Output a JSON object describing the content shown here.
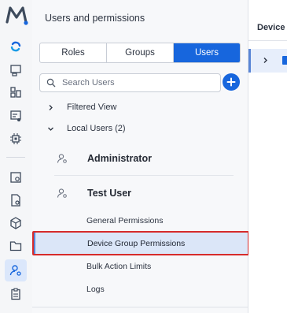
{
  "app": {
    "logo_letter": "M"
  },
  "panel": {
    "title": "Users and permissions",
    "tabs": [
      {
        "label": "Roles",
        "active": false
      },
      {
        "label": "Groups",
        "active": false
      },
      {
        "label": "Users",
        "active": true
      }
    ],
    "search": {
      "placeholder": "Search Users",
      "value": ""
    },
    "tree": {
      "filtered_view": "Filtered View",
      "local_users": "Local Users (2)"
    },
    "users": [
      {
        "name": "Administrator"
      },
      {
        "name": "Test User"
      }
    ],
    "sub_items": [
      "General Permissions",
      "Device Group Permissions",
      "Bulk Action Limits",
      "Logs"
    ],
    "selected_sub_item": "Device Group Permissions"
  },
  "right": {
    "header": "Device g"
  },
  "colors": {
    "accent": "#1766dd",
    "selected_bg": "#dbe6f8",
    "highlight": "#d62b2b"
  }
}
